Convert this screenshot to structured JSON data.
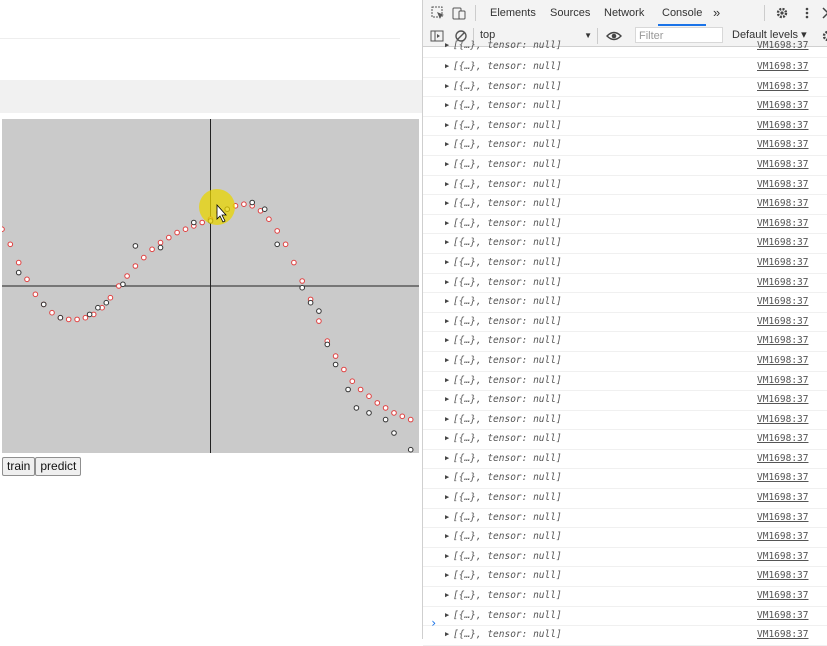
{
  "page": {
    "buttons": {
      "train": "train",
      "predict": "predict"
    },
    "colors": {
      "plot_bg": "#cacaca",
      "point_fill": "#ffffff",
      "point_stroke_red": "#e04040",
      "cursor_highlight": "#e8d400"
    }
  },
  "chart_data": {
    "type": "scatter",
    "title": "",
    "xlabel": "",
    "ylabel": "",
    "xlim": [
      -1,
      1
    ],
    "ylim": [
      -1,
      1
    ],
    "grid": false,
    "axes_through_origin": true,
    "series": [
      {
        "style": "red-outline",
        "points": [
          [
            -1.0,
            0.34
          ],
          [
            -0.96,
            0.25
          ],
          [
            -0.92,
            0.14
          ],
          [
            -0.88,
            0.04
          ],
          [
            -0.84,
            -0.05
          ],
          [
            -0.8,
            -0.11
          ],
          [
            -0.76,
            -0.16
          ],
          [
            -0.72,
            -0.19
          ],
          [
            -0.68,
            -0.2
          ],
          [
            -0.64,
            -0.2
          ],
          [
            -0.6,
            -0.19
          ],
          [
            -0.56,
            -0.17
          ],
          [
            -0.52,
            -0.13
          ],
          [
            -0.48,
            -0.07
          ],
          [
            -0.44,
            0.0
          ],
          [
            -0.4,
            0.06
          ],
          [
            -0.36,
            0.12
          ],
          [
            -0.32,
            0.17
          ],
          [
            -0.28,
            0.22
          ],
          [
            -0.24,
            0.26
          ],
          [
            -0.2,
            0.29
          ],
          [
            -0.16,
            0.32
          ],
          [
            -0.12,
            0.34
          ],
          [
            -0.08,
            0.36
          ],
          [
            -0.04,
            0.38
          ],
          [
            0.0,
            0.4
          ],
          [
            0.04,
            0.44
          ],
          [
            0.08,
            0.46
          ],
          [
            0.12,
            0.48
          ],
          [
            0.16,
            0.49
          ],
          [
            0.2,
            0.48
          ],
          [
            0.24,
            0.45
          ],
          [
            0.28,
            0.4
          ],
          [
            0.32,
            0.33
          ],
          [
            0.36,
            0.25
          ],
          [
            0.4,
            0.14
          ],
          [
            0.44,
            0.03
          ],
          [
            0.48,
            -0.08
          ],
          [
            0.52,
            -0.21
          ],
          [
            0.56,
            -0.33
          ],
          [
            0.6,
            -0.42
          ],
          [
            0.64,
            -0.5
          ],
          [
            0.68,
            -0.57
          ],
          [
            0.72,
            -0.62
          ],
          [
            0.76,
            -0.66
          ],
          [
            0.8,
            -0.7
          ],
          [
            0.84,
            -0.73
          ],
          [
            0.88,
            -0.76
          ],
          [
            0.92,
            -0.78
          ],
          [
            0.96,
            -0.8
          ]
        ]
      },
      {
        "style": "dark-outline",
        "points": [
          [
            -0.92,
            0.08
          ],
          [
            -0.8,
            -0.11
          ],
          [
            -0.72,
            -0.19
          ],
          [
            -0.58,
            -0.17
          ],
          [
            -0.54,
            -0.13
          ],
          [
            -0.5,
            -0.1
          ],
          [
            -0.42,
            0.01
          ],
          [
            -0.36,
            0.24
          ],
          [
            -0.24,
            0.23
          ],
          [
            -0.08,
            0.38
          ],
          [
            0.0,
            0.39
          ],
          [
            0.08,
            0.46
          ],
          [
            0.2,
            0.5
          ],
          [
            0.26,
            0.46
          ],
          [
            0.32,
            0.25
          ],
          [
            0.44,
            -0.01
          ],
          [
            0.48,
            -0.1
          ],
          [
            0.52,
            -0.15
          ],
          [
            0.56,
            -0.35
          ],
          [
            0.6,
            -0.47
          ],
          [
            0.66,
            -0.62
          ],
          [
            0.7,
            -0.73
          ],
          [
            0.76,
            -0.76
          ],
          [
            0.84,
            -0.8
          ],
          [
            0.88,
            -0.88
          ],
          [
            0.96,
            -0.98
          ]
        ]
      }
    ]
  },
  "devtools": {
    "tabs": [
      "Elements",
      "Sources",
      "Network",
      "Console"
    ],
    "active_tab": "Console",
    "more_tabs": "»",
    "context": "top",
    "filter_placeholder": "Filter",
    "levels": "Default levels ▾",
    "log_rows_count_visible": 31,
    "log_message": "[{…}, tensor: null]",
    "log_source": "VM1698:37",
    "prompt_symbol": "›"
  }
}
